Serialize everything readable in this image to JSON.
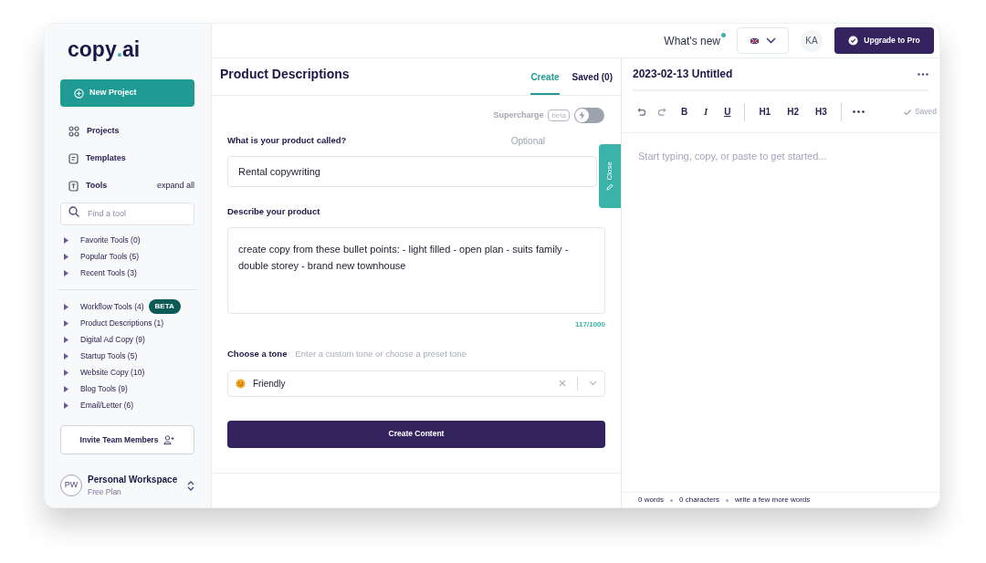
{
  "logo": {
    "name": "copy",
    "separator": ".",
    "suffix": "ai"
  },
  "sidebar": {
    "new_project": "New Project",
    "nav": [
      {
        "kind": "projects",
        "label": "Projects"
      },
      {
        "kind": "templates",
        "label": "Templates"
      },
      {
        "kind": "tools",
        "label": "Tools",
        "action": "expand all"
      }
    ],
    "search": {
      "placeholder": "Find a tool"
    },
    "tool_groups": [
      [
        {
          "label": "Favorite Tools (0)",
          "expanded": false
        },
        {
          "label": "Popular Tools (5)",
          "expanded": false
        },
        {
          "label": "Recent Tools (3)",
          "expanded": false
        }
      ],
      [
        {
          "label": "Workflow Tools (4)",
          "expanded": false,
          "badge": "BETA"
        },
        {
          "label": "Product Descriptions (1)",
          "expanded": false
        },
        {
          "label": "Digital Ad Copy (9)",
          "expanded": false
        },
        {
          "label": "Startup Tools (5)",
          "expanded": false
        },
        {
          "label": "Website Copy (10)",
          "expanded": false
        },
        {
          "label": "Blog Tools (9)",
          "expanded": false
        },
        {
          "label": "Email/Letter (6)",
          "expanded": false
        }
      ]
    ],
    "invite_button": "Invite Team Members",
    "workspace": {
      "initials": "PW",
      "name": "Personal Workspace",
      "plan": "Free Plan"
    }
  },
  "topbar": {
    "whats_new": "What's new",
    "whats_new_dot": true,
    "avatar": "KA",
    "upgrade_button": "Upgrade to Pro"
  },
  "form": {
    "title": "Product Descriptions",
    "tabs": [
      {
        "label": "Create",
        "selected": true
      },
      {
        "label": "Saved (0)",
        "selected": false
      }
    ],
    "supercharge": {
      "label": "Supercharge",
      "badge": "beta",
      "on": false
    },
    "close_tab": "Close",
    "name_field": {
      "label": "What is your product called?",
      "hint": "Optional",
      "value": "Rental copywriting"
    },
    "description_field": {
      "label": "Describe your product",
      "value": "create copy from these bullet points: - light filled - open plan - suits family - double storey - brand new townhouse",
      "counter": "117/1000"
    },
    "tone": {
      "label": "Choose a tone",
      "hint": "Enter a custom tone or choose a preset tone",
      "value": "Friendly"
    },
    "submit_button": "Create Content"
  },
  "editor": {
    "title": "2023-02-13 Untitled",
    "toolbar": [
      {
        "kind": "undo"
      },
      {
        "kind": "redo"
      },
      {
        "kind": "bold",
        "label": "B"
      },
      {
        "kind": "italic",
        "label": "I"
      },
      {
        "kind": "underline",
        "label": "U"
      },
      {
        "kind": "divider"
      },
      {
        "kind": "heading",
        "label": "H1"
      },
      {
        "kind": "heading",
        "label": "H2"
      },
      {
        "kind": "heading",
        "label": "H3"
      },
      {
        "kind": "divider"
      },
      {
        "kind": "more"
      }
    ],
    "saved": "Saved",
    "placeholder": "Start typing, copy, or paste to get started...",
    "footer": [
      "0 words",
      "0 characters",
      "write a few more words"
    ]
  }
}
